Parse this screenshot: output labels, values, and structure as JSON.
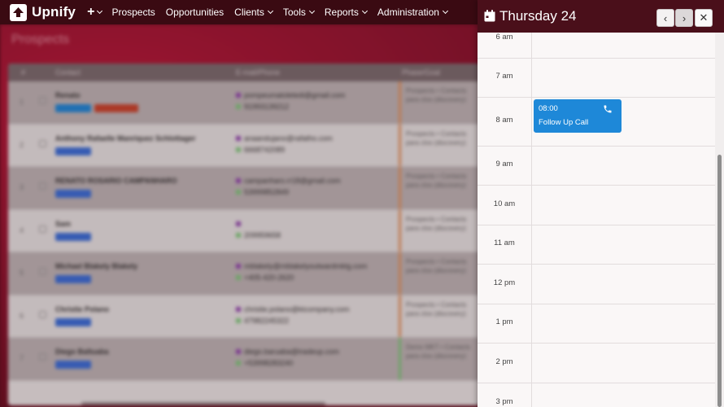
{
  "brand": {
    "name": "Upnify"
  },
  "nav": {
    "items": [
      {
        "label": "Prospects",
        "caret": false
      },
      {
        "label": "Opportunities",
        "caret": false
      },
      {
        "label": "Clients",
        "caret": true
      },
      {
        "label": "Tools",
        "caret": true
      },
      {
        "label": "Reports",
        "caret": true
      },
      {
        "label": "Administration",
        "caret": true
      }
    ]
  },
  "background_page": {
    "title": "Prospects",
    "columns": [
      "#",
      "Contact",
      "E-mail/Phone",
      "Phase/Goal"
    ],
    "rows": [
      {
        "index": "1",
        "name": "Renato",
        "email": "pompeumatoletedi@gmail.com",
        "phone": "91993139212",
        "stage": "Prospects • Contacts para clos (discovery)"
      },
      {
        "index": "2",
        "name": "Anthony Rafaelle Manriquez Schlottager",
        "email": "anaandujano@rafatho.com",
        "phone": "6668742089",
        "stage": "Prospects • Contacts para clos (discovery)"
      },
      {
        "index": "3",
        "name": "RENATO ROSARIO CAMPANHARO",
        "email": "campanharo.rr18@gmail.com",
        "phone": "53999852849",
        "stage": "Prospects • Contacts para clos (discovery)"
      },
      {
        "index": "4",
        "name": "Sam",
        "email": "",
        "phone": "209959658",
        "stage": "Prospects • Contacts para clos (discovery)"
      },
      {
        "index": "5",
        "name": "Michael Blakely Blakely",
        "email": "mblakely@mblakelyoutwardmktg.com",
        "phone": "+405-420-2620",
        "stage": "Prospects • Contacts para clos (discovery)"
      },
      {
        "index": "6",
        "name": "Christie Polano",
        "email": "christie.polano@ktcompany.com",
        "phone": "47982245322",
        "stage": "Prospects • Contacts para clos (discovery)"
      },
      {
        "index": "7",
        "name": "Diego Baltuaba",
        "email": "diego.baruaba@tradeup.com",
        "phone": "+53998283240",
        "stage": "Demo MKT • Contacts para clos (discovery)"
      }
    ]
  },
  "calendar": {
    "title": "Thursday 24",
    "prev_label": "‹",
    "next_label": "›",
    "close_label": "✕",
    "hours": [
      "6 am",
      "7 am",
      "8 am",
      "9 am",
      "10 am",
      "11 am",
      "12 pm",
      "1 pm",
      "2 pm",
      "3 pm"
    ],
    "event": {
      "time": "08:00",
      "title": "Follow Up Call",
      "icon": "phone-icon",
      "color": "#1e88d8"
    }
  },
  "colors": {
    "nav_bg": "#3a0a12",
    "panel_header": "#4a0f1a",
    "accent": "#1e88d8"
  }
}
